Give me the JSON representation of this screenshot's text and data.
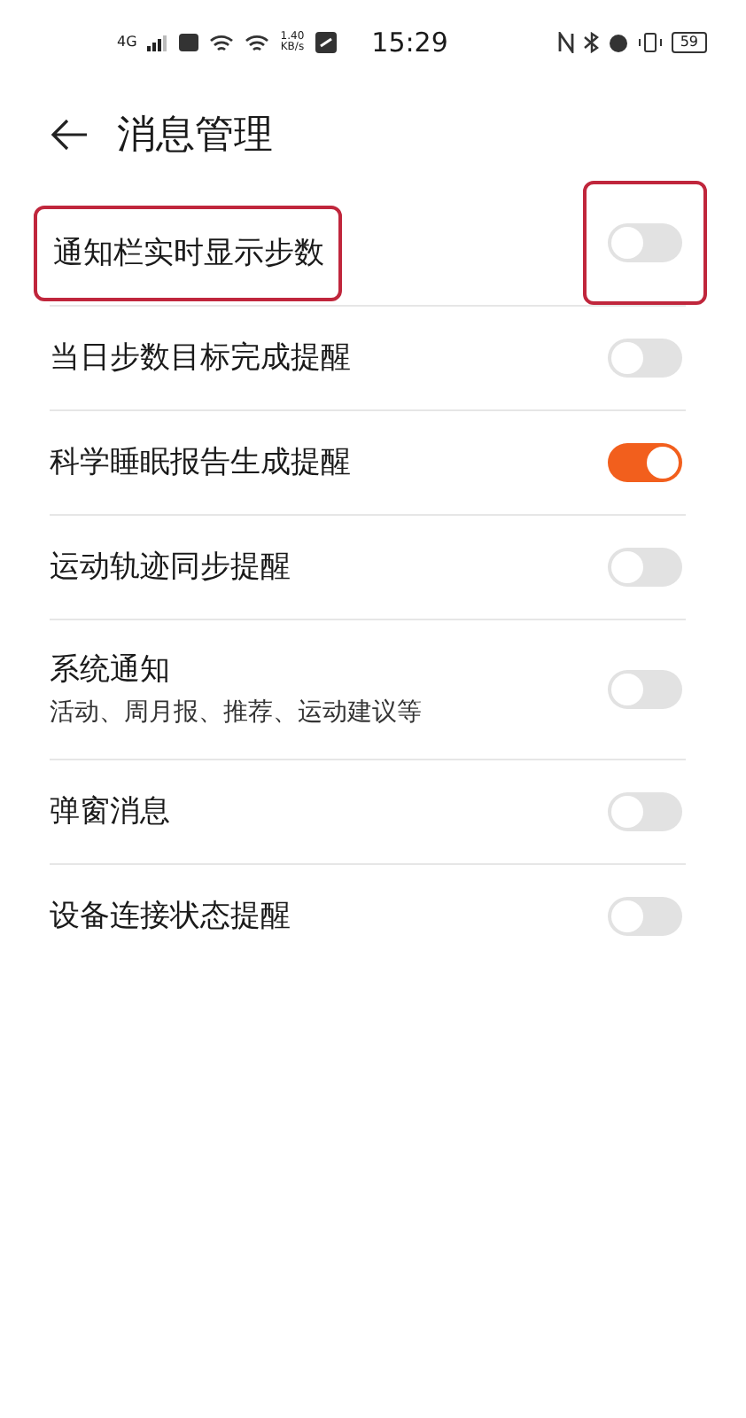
{
  "status_bar": {
    "network": "4G",
    "speed": "1.40",
    "speed_unit": "KB/s",
    "time": "15:29",
    "battery": "59"
  },
  "header": {
    "title": "消息管理"
  },
  "settings": [
    {
      "label": "通知栏实时显示步数",
      "on": false,
      "highlighted": true
    },
    {
      "label": "当日步数目标完成提醒",
      "on": false,
      "highlighted": false
    },
    {
      "label": "科学睡眠报告生成提醒",
      "on": true,
      "highlighted": false
    },
    {
      "label": "运动轨迹同步提醒",
      "on": false,
      "highlighted": false
    },
    {
      "label": "系统通知",
      "sublabel": "活动、周月报、推荐、运动建议等",
      "on": false,
      "highlighted": false
    },
    {
      "label": "弹窗消息",
      "on": false,
      "highlighted": false
    },
    {
      "label": "设备连接状态提醒",
      "on": false,
      "highlighted": false
    }
  ]
}
